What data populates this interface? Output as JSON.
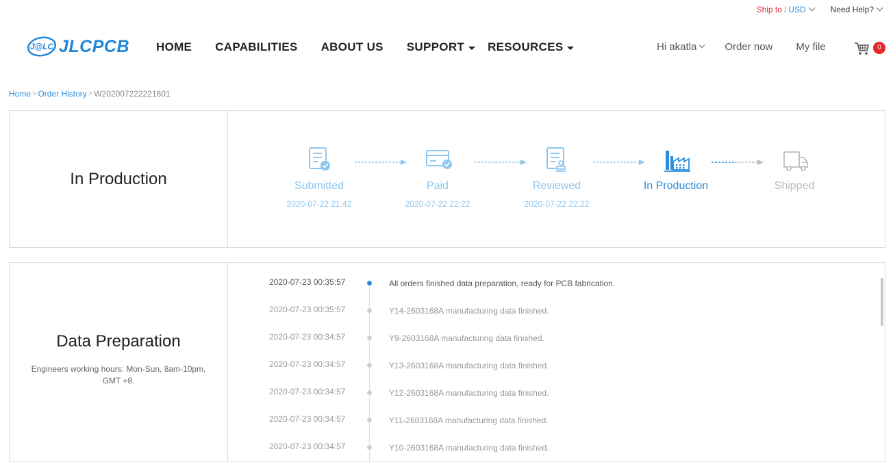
{
  "topbar": {
    "ship_label": "Ship to",
    "separator": "/",
    "currency": "USD",
    "need_help": "Need Help?"
  },
  "logo": {
    "badge": "J@LC",
    "text": "JLCPCB"
  },
  "nav": {
    "home": "HOME",
    "capabilities": "CAPABILITIES",
    "about": "ABOUT US",
    "support": "SUPPORT",
    "resources": "RESOURCES"
  },
  "user_nav": {
    "greeting": "Hi akatla",
    "order_now": "Order now",
    "my_file": "My file",
    "cart_count": "0"
  },
  "breadcrumb": {
    "home": "Home",
    "order_history": "Order History",
    "order_id": "W202007222221601"
  },
  "status": {
    "title": "In Production",
    "steps": [
      {
        "label": "Submitted",
        "time": "2020-07-22 21:42",
        "icon": "document-check-icon"
      },
      {
        "label": "Paid",
        "time": "2020-07-22 22:22",
        "icon": "card-check-icon"
      },
      {
        "label": "Reviewed",
        "time": "2020-07-22 22:22",
        "icon": "document-stamp-icon"
      },
      {
        "label": "In Production",
        "time": "",
        "icon": "factory-icon"
      },
      {
        "label": "Shipped",
        "time": "",
        "icon": "truck-icon"
      }
    ]
  },
  "data_prep": {
    "title": "Data Preparation",
    "note": "Engineers working hours: Mon-Sun, 8am-10pm, GMT +8.",
    "events": [
      {
        "time": "2020-07-23 00:35:57",
        "message": "All orders finished data preparation, ready for PCB fabrication."
      },
      {
        "time": "2020-07-23 00:35:57",
        "message": "Y14-2603168A manufacturing data finished."
      },
      {
        "time": "2020-07-23 00:34:57",
        "message": "Y9-2603168A manufacturing data finished."
      },
      {
        "time": "2020-07-23 00:34:57",
        "message": "Y13-2603168A manufacturing data finished."
      },
      {
        "time": "2020-07-23 00:34:57",
        "message": "Y12-2603168A manufacturing data finished."
      },
      {
        "time": "2020-07-23 00:34:57",
        "message": "Y11-2603168A manufacturing data finished."
      },
      {
        "time": "2020-07-23 00:34:57",
        "message": "Y10-2603168A manufacturing data finished."
      }
    ]
  },
  "colors": {
    "accent": "#2c8ddd",
    "accent_light": "#8fc6ef",
    "ship_red": "#e0282e",
    "badge_red": "#e8262a"
  }
}
